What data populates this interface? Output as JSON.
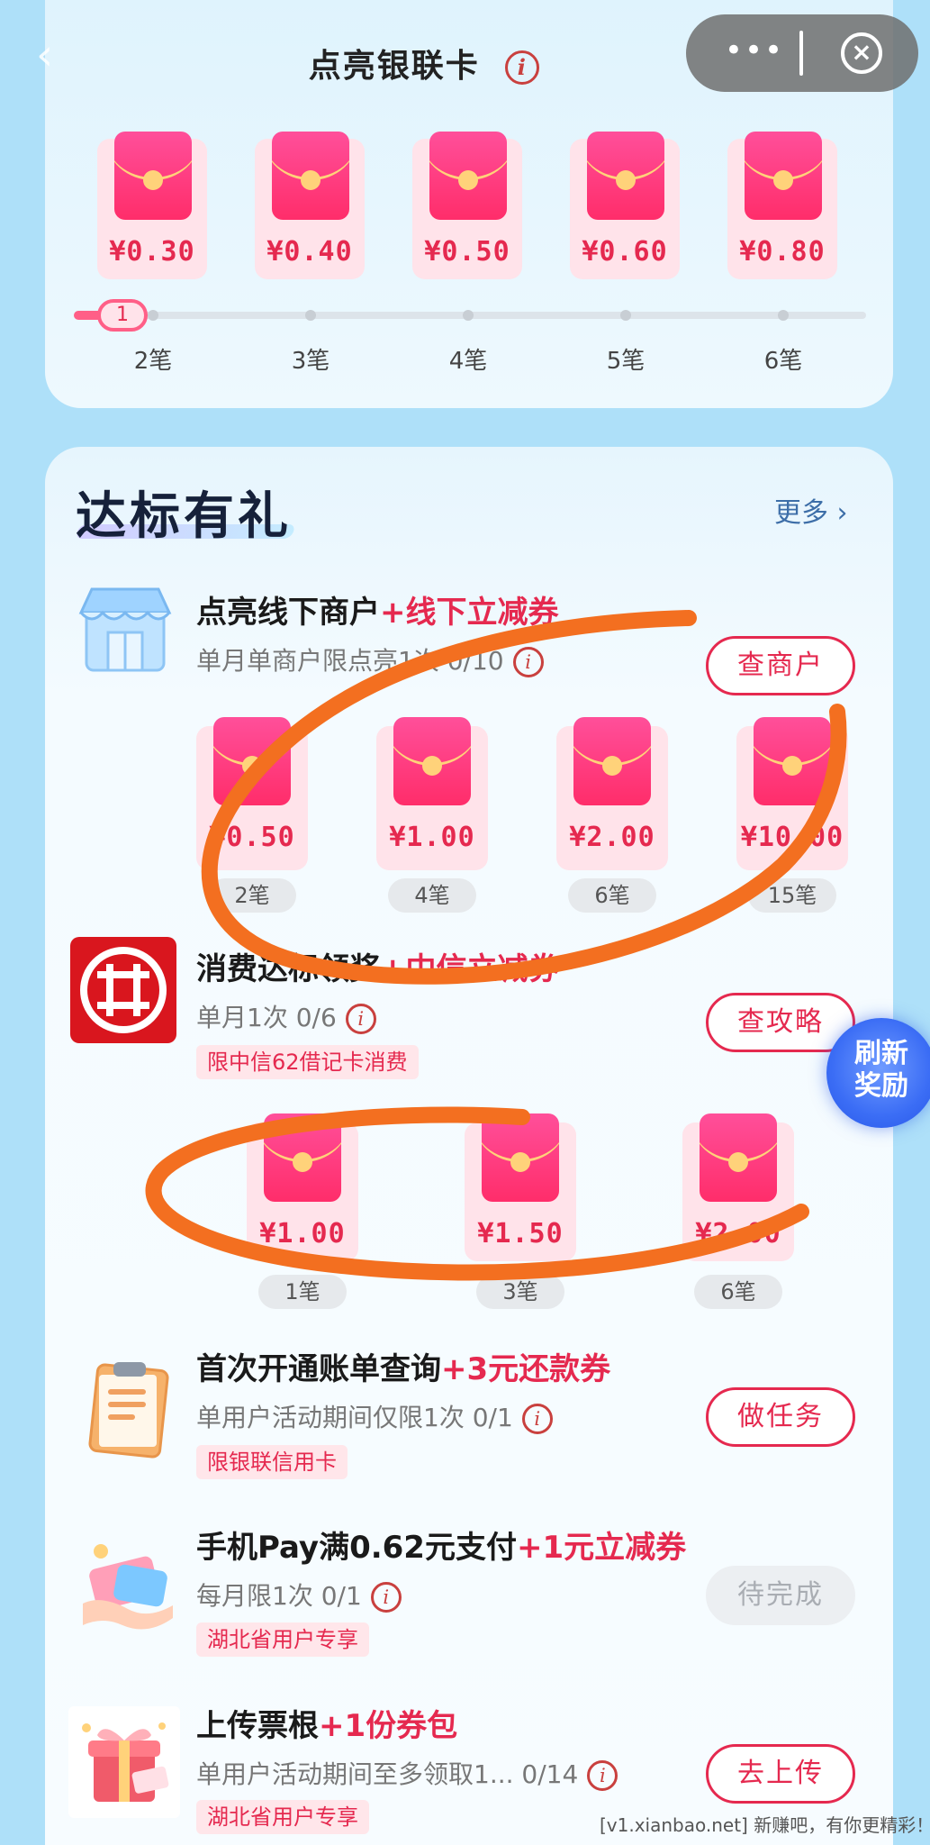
{
  "header": {
    "title": "点亮银联卡",
    "info_icon": "i",
    "capsule_more": "•••",
    "capsule_close": "×",
    "back_icon": "‹"
  },
  "top_rewards": {
    "packets": [
      {
        "amount": "¥0.30",
        "stage": "2笔"
      },
      {
        "amount": "¥0.40",
        "stage": "3笔"
      },
      {
        "amount": "¥0.50",
        "stage": "4笔"
      },
      {
        "amount": "¥0.60",
        "stage": "5笔"
      },
      {
        "amount": "¥0.80",
        "stage": "6笔"
      }
    ],
    "progress_current": "1"
  },
  "section": {
    "title": "达标有礼",
    "more": "更多 ›"
  },
  "tasks": [
    {
      "title": "点亮线下商户",
      "highlight": "+线下立减券",
      "subtitle": "单月单商户限点亮1次  0/10",
      "button": "查商户",
      "rewards": [
        {
          "amount": "¥0.50",
          "stage": "2笔"
        },
        {
          "amount": "¥1.00",
          "stage": "4笔"
        },
        {
          "amount": "¥2.00",
          "stage": "6笔"
        },
        {
          "amount": "¥10.00",
          "stage": "15笔"
        }
      ]
    },
    {
      "title": "消费达标领奖",
      "highlight": "+中信立减券",
      "subtitle": "单月1次  0/6",
      "tag": "限中信62借记卡消费",
      "button": "查攻略",
      "rewards": [
        {
          "amount": "¥1.00",
          "stage": "1笔"
        },
        {
          "amount": "¥1.50",
          "stage": "3笔"
        },
        {
          "amount": "¥2.00",
          "stage": "6笔"
        }
      ]
    },
    {
      "title": "首次开通账单查询",
      "highlight": "+3元还款券",
      "subtitle": "单用户活动期间仅限1次  0/1",
      "tag": "限银联信用卡",
      "button": "做任务"
    },
    {
      "title": "手机Pay满0.62元支付",
      "highlight": "+1元立减券",
      "subtitle": "每月限1次  0/1",
      "tag": "湖北省用户专享",
      "button": "待完成"
    },
    {
      "title": "上传票根",
      "highlight": "+1份券包",
      "subtitle": "单用户活动期间至多领取1...  0/14",
      "tag": "湖北省用户专享",
      "button": "去上传"
    }
  ],
  "refresh_bubble": {
    "line1": "刷新",
    "line2": "奖励"
  },
  "watermark": "[v1.xianbao.net] 新赚吧，有你更精彩！",
  "colors": {
    "accent": "#e5294f",
    "background": "#aee0f9",
    "annotation": "#f36f20"
  },
  "icons": [
    "back-icon",
    "more-dots-icon",
    "close-circle-icon",
    "info-icon",
    "store-icon",
    "citic-logo-icon",
    "clipboard-icon",
    "payment-card-icon",
    "gift-box-icon",
    "red-packet-icon"
  ]
}
